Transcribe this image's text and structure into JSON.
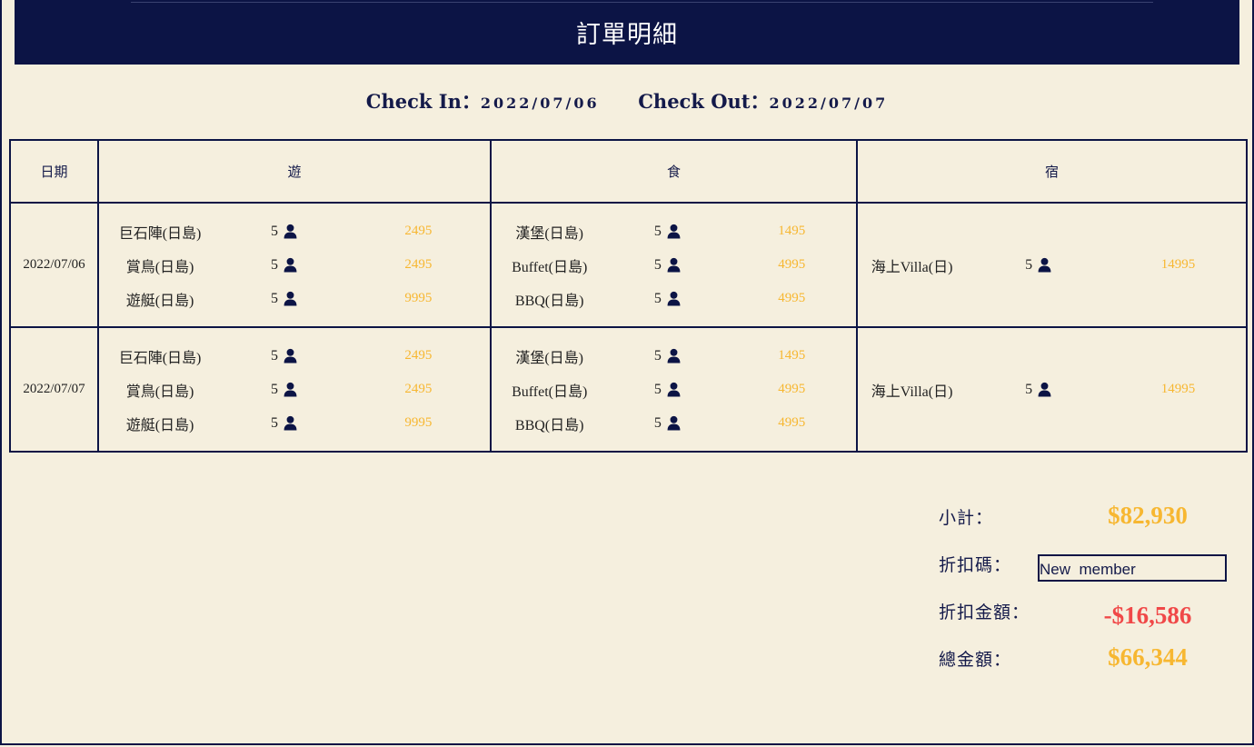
{
  "header": {
    "title": "訂單明細"
  },
  "stay": {
    "check_in_label": "Check In：",
    "check_in_value": "2022/07/06",
    "check_out_label": "Check Out：",
    "check_out_value": "2022/07/07"
  },
  "table": {
    "headers": [
      "日期",
      "遊",
      "食",
      "宿"
    ],
    "rows": [
      {
        "date": "2022/07/06",
        "you": [
          {
            "name": "巨石陣(日島)",
            "qty": "5",
            "price": "2495"
          },
          {
            "name": "賞鳥(日島)",
            "qty": "5",
            "price": "2495"
          },
          {
            "name": "遊艇(日島)",
            "qty": "5",
            "price": "9995"
          }
        ],
        "shi": [
          {
            "name": "漢堡(日島)",
            "qty": "5",
            "price": "1495"
          },
          {
            "name": "Buffet(日島)",
            "qty": "5",
            "price": "4995"
          },
          {
            "name": "BBQ(日島)",
            "qty": "5",
            "price": "4995"
          }
        ],
        "su": [
          {
            "name": "海上Villa(日)",
            "qty": "5",
            "price": "14995"
          }
        ]
      },
      {
        "date": "2022/07/07",
        "you": [
          {
            "name": "巨石陣(日島)",
            "qty": "5",
            "price": "2495"
          },
          {
            "name": "賞鳥(日島)",
            "qty": "5",
            "price": "2495"
          },
          {
            "name": "遊艇(日島)",
            "qty": "5",
            "price": "9995"
          }
        ],
        "shi": [
          {
            "name": "漢堡(日島)",
            "qty": "5",
            "price": "1495"
          },
          {
            "name": "Buffet(日島)",
            "qty": "5",
            "price": "4995"
          },
          {
            "name": "BBQ(日島)",
            "qty": "5",
            "price": "4995"
          }
        ],
        "su": [
          {
            "name": "海上Villa(日)",
            "qty": "5",
            "price": "14995"
          }
        ]
      }
    ],
    "person_icon": "person-icon"
  },
  "summary": {
    "subtotal_label": "小計：",
    "subtotal_value": "$82,930",
    "discount_code_label": "折扣碼：",
    "discount_code_value": "New  member",
    "discount_amount_label": "折扣金額：",
    "discount_amount_value": "-$16,586",
    "total_label": "總金額：",
    "total_value": "$66,344"
  },
  "colors": {
    "navy": "#0c1445",
    "background": "#f5efde",
    "price": "#f7b731",
    "discount": "#f04848"
  }
}
